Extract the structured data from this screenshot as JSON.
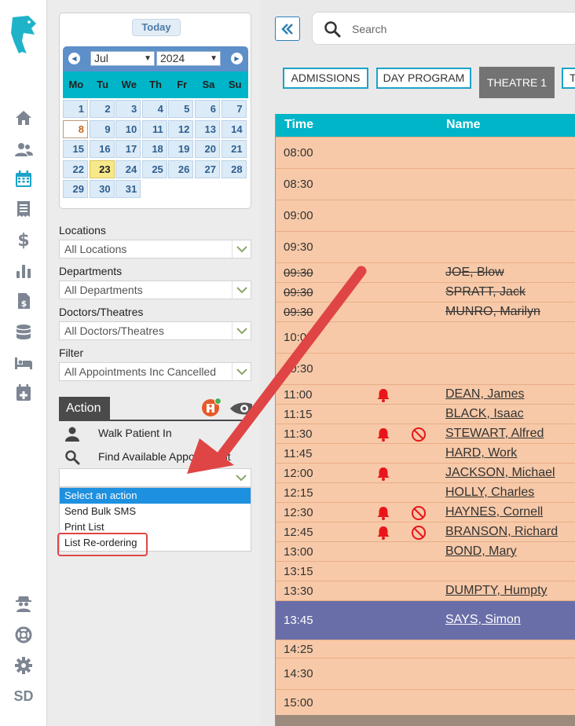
{
  "rail": {
    "initials": "SD",
    "icons": [
      "home-icon",
      "users-icon",
      "calendar-icon",
      "receipt-icon",
      "dollar-icon",
      "bar-chart-icon",
      "invoice-icon",
      "database-icon",
      "bed-icon",
      "calendar-plus-icon",
      "spy-icon",
      "lifebuoy-icon",
      "gear-icon"
    ]
  },
  "calendar": {
    "today_label": "Today",
    "month": "Jul",
    "year": "2024",
    "weekdays": [
      "Mo",
      "Tu",
      "We",
      "Th",
      "Fr",
      "Sa",
      "Su"
    ],
    "today_day": 23,
    "selected_day": 8
  },
  "filters": {
    "locations_label": "Locations",
    "locations_value": "All Locations",
    "departments_label": "Departments",
    "departments_value": "All Departments",
    "doctors_label": "Doctors/Theatres",
    "doctors_value": "All Doctors/Theatres",
    "filter_label": "Filter",
    "filter_value": "All Appointments Inc Cancelled"
  },
  "action": {
    "tab_label": "Action",
    "walk_in_label": "Walk Patient In",
    "find_label": "Find Available Appointment",
    "options": [
      "Select an action",
      "Send Bulk SMS",
      "Print List",
      "List Re-ordering"
    ]
  },
  "header": {
    "search_placeholder": "Search",
    "tabs": [
      "ADMISSIONS",
      "DAY PROGRAM",
      "THEATRE 1",
      "T"
    ]
  },
  "schedule": {
    "col_time": "Time",
    "col_name": "Name",
    "rows": [
      {
        "time": "08:00",
        "name": ""
      },
      {
        "time": "08:30",
        "name": ""
      },
      {
        "time": "09:00",
        "name": ""
      },
      {
        "time": "09:30",
        "name": ""
      },
      {
        "time": "09:30",
        "name": "JOE, Blow"
      },
      {
        "time": "09:30",
        "name": "SPRATT, Jack"
      },
      {
        "time": "09:30",
        "name": "MUNRO, Marilyn"
      },
      {
        "time": "10:00",
        "name": ""
      },
      {
        "time": "10:30",
        "name": ""
      },
      {
        "time": "11:00",
        "name": "DEAN, James"
      },
      {
        "time": "11:15",
        "name": "BLACK, Isaac"
      },
      {
        "time": "11:30",
        "name": "STEWART, Alfred"
      },
      {
        "time": "11:45",
        "name": "HARD, Work"
      },
      {
        "time": "12:00",
        "name": "JACKSON, Michael"
      },
      {
        "time": "12:15",
        "name": "HOLLY, Charles"
      },
      {
        "time": "12:30",
        "name": "HAYNES, Cornell"
      },
      {
        "time": "12:45",
        "name": "BRANSON, Richard"
      },
      {
        "time": "13:00",
        "name": "BOND, Mary"
      },
      {
        "time": "13:15",
        "name": ""
      },
      {
        "time": "13:30",
        "name": "DUMPTY, Humpty"
      },
      {
        "time": "13:45",
        "name": "SAYS, Simon"
      },
      {
        "time": "14:25",
        "name": ""
      },
      {
        "time": "14:30",
        "name": ""
      },
      {
        "time": "15:00",
        "name": ""
      }
    ]
  },
  "colors": {
    "accent_teal": "#00b5c8",
    "schedule_bg": "#f7c9a8",
    "selected_row": "#6a6ea8",
    "annotation_red": "#e04545"
  }
}
